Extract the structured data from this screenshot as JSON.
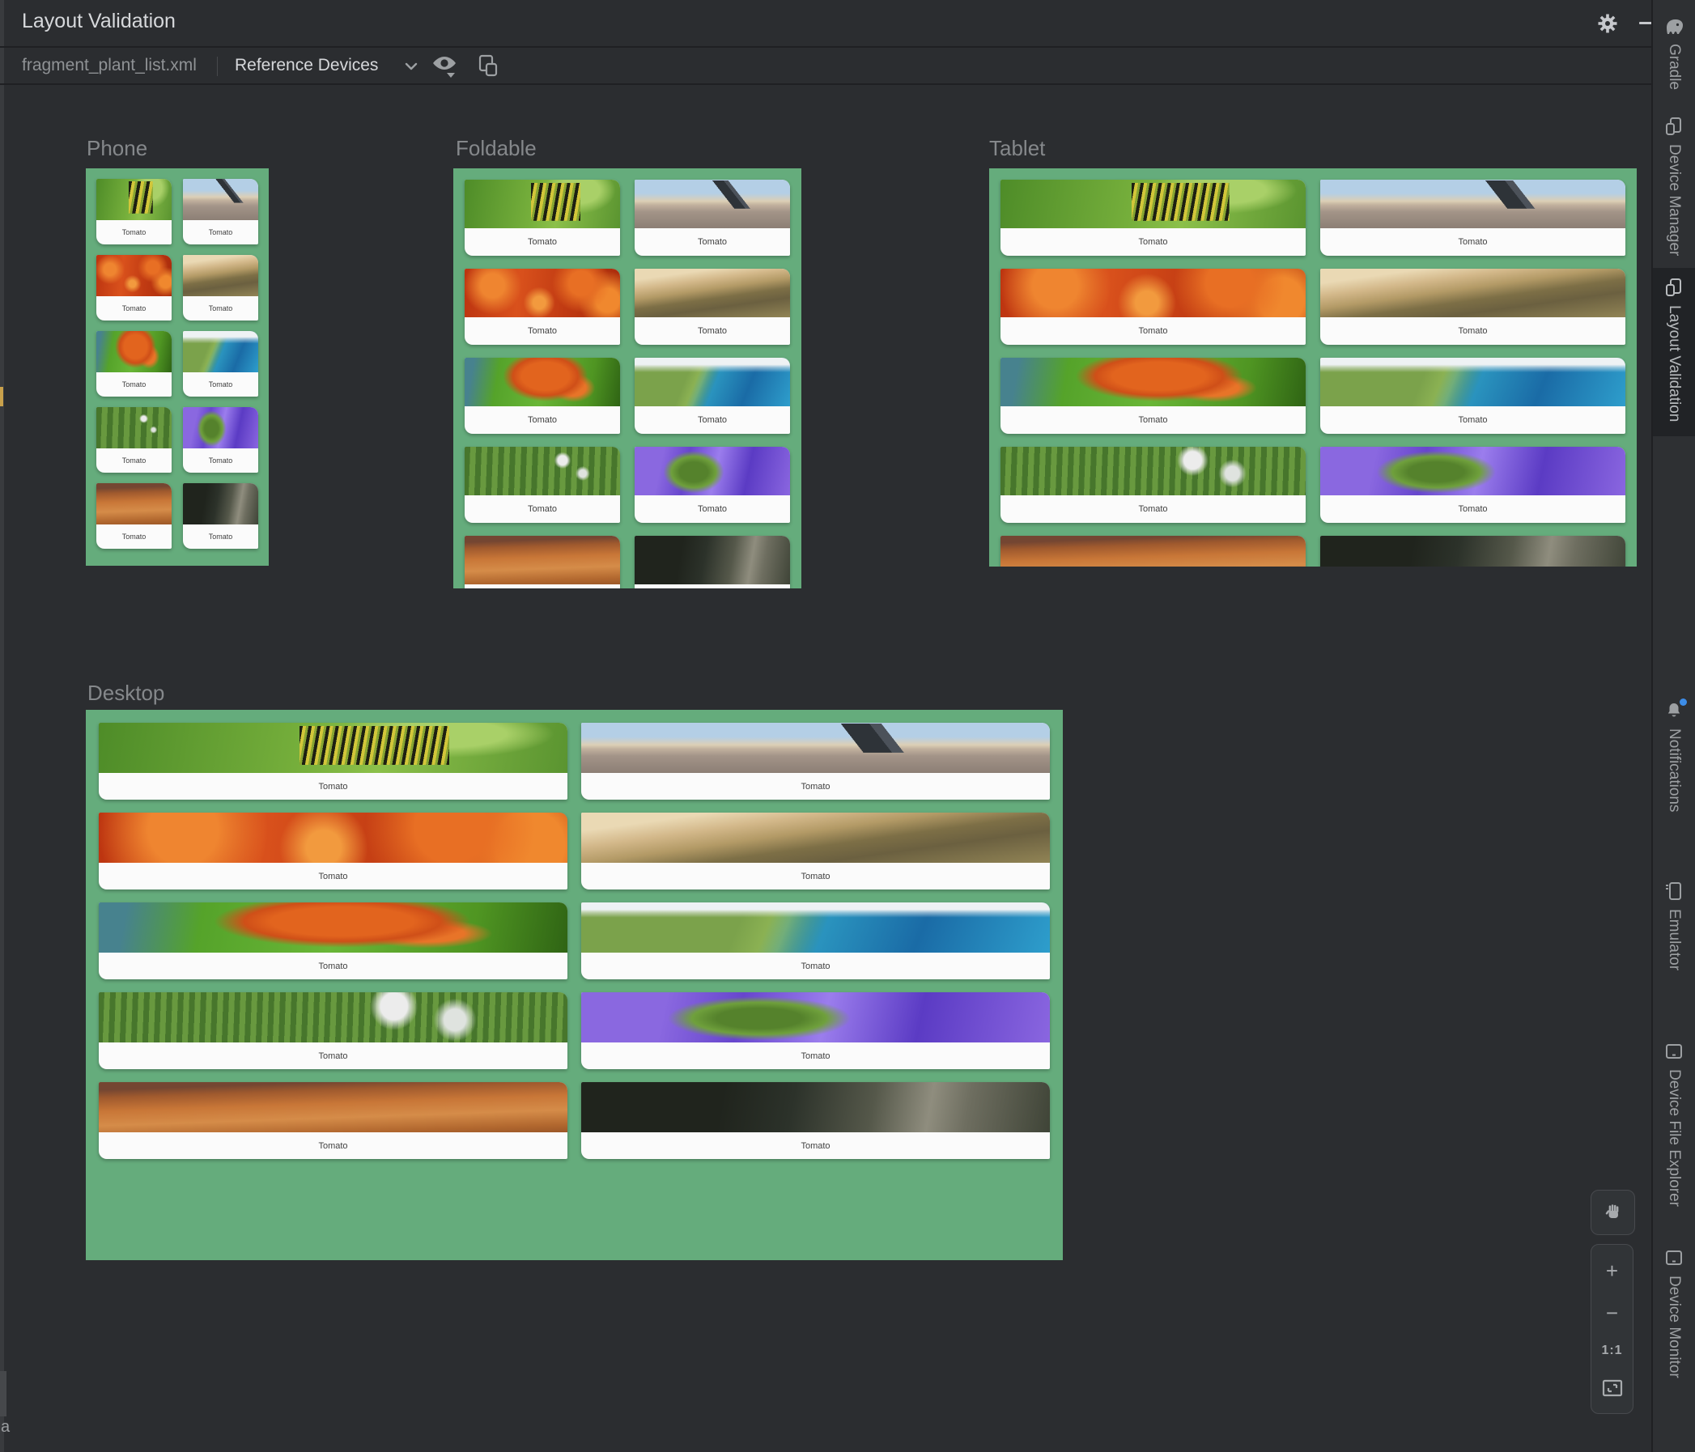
{
  "window": {
    "title": "Layout Validation"
  },
  "toolbar": {
    "file_tab": "fragment_plant_list.xml",
    "device_selector": "Reference Devices"
  },
  "plant": {
    "label": "Tomato"
  },
  "images": [
    "caterpillar",
    "telescope-city",
    "red-maple",
    "wood-drops",
    "orange-maple",
    "coastal-aerial",
    "farm-aerial",
    "purple-river",
    "desert-canyon",
    "dark-forest"
  ],
  "devices": [
    {
      "name": "Phone",
      "cards": 10
    },
    {
      "name": "Foldable",
      "cards": 10
    },
    {
      "name": "Tablet",
      "cards": 10
    },
    {
      "name": "Desktop",
      "cards": 10
    }
  ],
  "sidebar": {
    "items": [
      {
        "label": "Gradle",
        "icon": "gradle-elephant-icon",
        "active": false
      },
      {
        "label": "Device Manager",
        "icon": "device-phone-icon",
        "active": false
      },
      {
        "label": "Layout Validation",
        "icon": "device-phone-icon",
        "active": true
      },
      {
        "label": "Notifications",
        "icon": "bell-icon",
        "active": false,
        "has_badge": true
      },
      {
        "label": "Emulator",
        "icon": "emulator-icon",
        "active": false
      },
      {
        "label": "Device File Explorer",
        "icon": "tablet-icon",
        "active": false
      },
      {
        "label": "Device Monitor",
        "icon": "tablet-icon",
        "active": false
      }
    ]
  },
  "zoom_controls": {
    "zoom_in": "+",
    "zoom_out": "−",
    "actual_size": "1:1"
  },
  "edge": {
    "fragment_text": "a"
  },
  "colors": {
    "panel_green": "#65ac7c",
    "canvas": "#2b2d30",
    "card_bg": "#fbfbfb",
    "notification_badge": "#3d8de8"
  }
}
